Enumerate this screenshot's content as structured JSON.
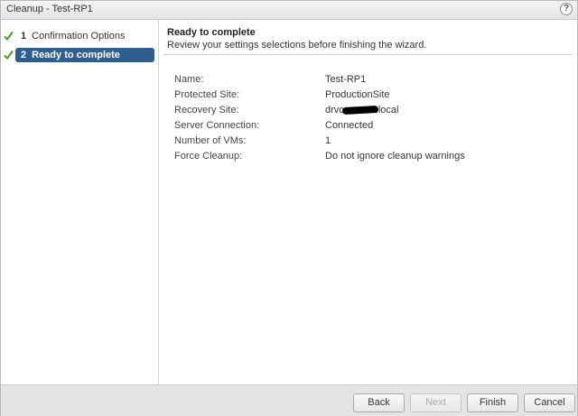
{
  "window": {
    "title": "Cleanup - Test-RP1",
    "help_icon": "help-icon",
    "help_glyph": "?"
  },
  "steps": [
    {
      "number": "1",
      "label": "Confirmation Options",
      "completed": true,
      "active": false
    },
    {
      "number": "2",
      "label": "Ready to complete",
      "completed": true,
      "active": true
    }
  ],
  "main": {
    "heading": "Ready to complete",
    "subheading": "Review your settings selections before finishing the wizard.",
    "summary": [
      {
        "label": "Name:",
        "value": "Test-RP1"
      },
      {
        "label": "Protected Site:",
        "value": "ProductionSite"
      },
      {
        "label": "Recovery Site:",
        "value_prefix": "drvc",
        "value_suffix": ".local",
        "redacted": true
      },
      {
        "label": "Server Connection:",
        "value": "Connected"
      },
      {
        "label": "Number of VMs:",
        "value": "1"
      },
      {
        "label": "Force Cleanup:",
        "value": "Do not ignore cleanup warnings"
      }
    ]
  },
  "footer": {
    "back_label": "Back",
    "next_label": "Next",
    "finish_label": "Finish",
    "cancel_label": "Cancel"
  },
  "colors": {
    "active_step": "#2f5f8e",
    "check": "#4a9a2a",
    "footer_bg": "#e4e4e4"
  }
}
